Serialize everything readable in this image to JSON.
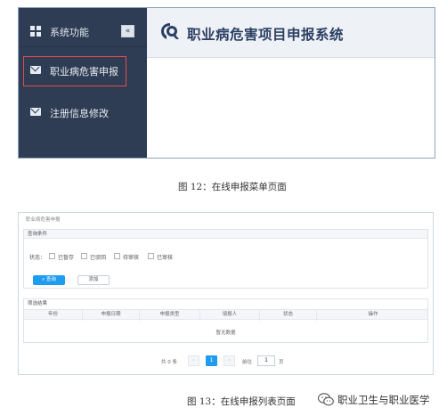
{
  "fig12": {
    "sidebar": {
      "header_label": "系统功能",
      "collapse_glyph": "«",
      "items": [
        {
          "label": "职业病危害申报",
          "icon": "mail-icon",
          "highlighted": true
        },
        {
          "label": "注册信息修改",
          "icon": "mail-icon",
          "highlighted": false
        }
      ]
    },
    "header": {
      "title": "职业病危害项目申报系统",
      "logo": "logo-icon"
    },
    "caption": "图 12：在线申报菜单页面"
  },
  "fig13": {
    "breadcrumb": "职业病危害申报",
    "query_panel": {
      "title": "查询条件",
      "status_label": "状态：",
      "options": [
        "已暂存",
        "已驳回",
        "待审核",
        "已审核"
      ],
      "query_button": "查询",
      "add_button": "添加"
    },
    "result_panel": {
      "title": "筛选结果",
      "columns": [
        "年份",
        "申报日期",
        "申报类型",
        "填报人",
        "状态",
        "操作"
      ],
      "empty_text": "暂无数据"
    },
    "pager": {
      "total": "共 0 条",
      "prev": "‹",
      "current": "1",
      "next": "›",
      "goto_label": "前往",
      "goto_value": "1",
      "page_unit": "页"
    },
    "caption": "图 13：在线申报列表页面"
  },
  "watermark": {
    "text": "职业卫生与职业医学",
    "icon": "wechat-icon"
  },
  "colors": {
    "sidebar": "#2f3d54",
    "highlight_border": "#e24a4a",
    "primary": "#1e9cf0",
    "title": "#2b3e63"
  }
}
